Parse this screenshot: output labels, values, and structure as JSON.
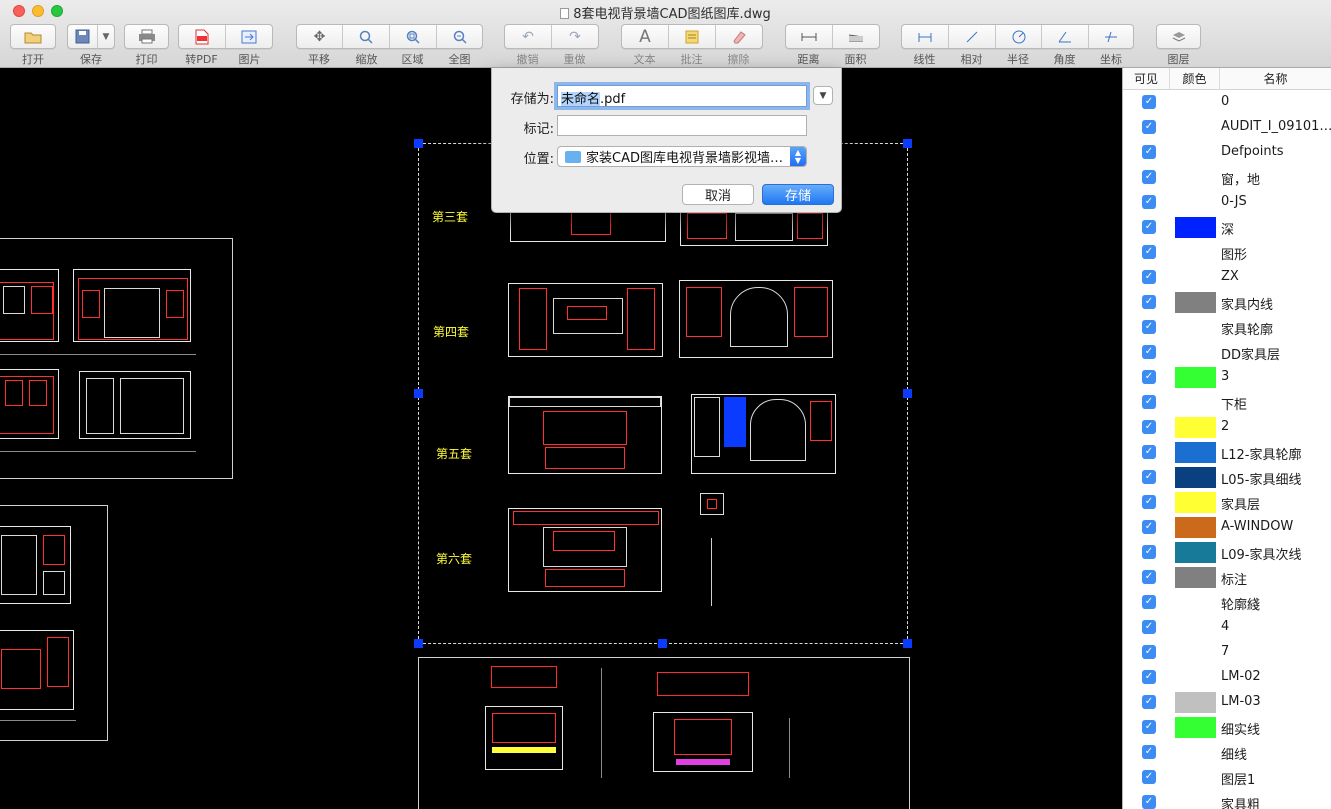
{
  "window": {
    "title": "8套电视背景墙CAD图纸图库.dwg"
  },
  "toolbar": {
    "open": "打开",
    "save": "保存",
    "print": "打印",
    "to_pdf": "转PDF",
    "image": "图片",
    "pan": "平移",
    "zoom": "缩放",
    "region": "区域",
    "full": "全图",
    "undo": "撤销",
    "redo": "重做",
    "text": "文本",
    "annotate": "批注",
    "erase": "擦除",
    "distance": "距离",
    "area": "面积",
    "linear": "线性",
    "relative": "相对",
    "radius": "半径",
    "angle": "角度",
    "coordinate": "坐标",
    "layers": "图层"
  },
  "dialog": {
    "save_as_label": "存储为:",
    "save_as_value_selected": "未命名",
    "save_as_value_ext": ".pdf",
    "tags_label": "标记:",
    "tags_value": "",
    "location_label": "位置:",
    "location_value": "家装CAD图库电视背景墙影视墙…",
    "cancel": "取消",
    "save": "存储"
  },
  "canvas": {
    "labels": [
      "第三套",
      "第四套",
      "第五套",
      "第六套"
    ]
  },
  "layers_panel": {
    "headers": {
      "visible": "可见",
      "color": "颜色",
      "name": "名称"
    },
    "rows": [
      {
        "name": "0",
        "color": ""
      },
      {
        "name": "AUDIT_I_09101…",
        "color": ""
      },
      {
        "name": "Defpoints",
        "color": ""
      },
      {
        "name": "窗，地",
        "color": ""
      },
      {
        "name": "0-JS",
        "color": ""
      },
      {
        "name": "深",
        "color": "#0022ff"
      },
      {
        "name": "图形",
        "color": ""
      },
      {
        "name": "ZX",
        "color": ""
      },
      {
        "name": "家具内线",
        "color": "#808080"
      },
      {
        "name": "家具轮廓",
        "color": ""
      },
      {
        "name": "DD家具层",
        "color": ""
      },
      {
        "name": "3",
        "color": "#33ff33"
      },
      {
        "name": "下柜",
        "color": ""
      },
      {
        "name": "2",
        "color": "#ffff33"
      },
      {
        "name": "L12-家具轮廓",
        "color": "#1a6fd0"
      },
      {
        "name": "L05-家具细线",
        "color": "#0a3f80"
      },
      {
        "name": "家具层",
        "color": "#ffff33"
      },
      {
        "name": "A-WINDOW",
        "color": "#cc6a1c"
      },
      {
        "name": "L09-家具次线",
        "color": "#177a98"
      },
      {
        "name": "标注",
        "color": "#808080"
      },
      {
        "name": "轮廓綫",
        "color": ""
      },
      {
        "name": "4",
        "color": ""
      },
      {
        "name": "7",
        "color": ""
      },
      {
        "name": "LM-02",
        "color": ""
      },
      {
        "name": "LM-03",
        "color": "#c0c0c0"
      },
      {
        "name": "细实线",
        "color": "#33ff33"
      },
      {
        "name": "细线",
        "color": ""
      },
      {
        "name": "图层1",
        "color": ""
      },
      {
        "name": "家具粗",
        "color": ""
      }
    ]
  }
}
